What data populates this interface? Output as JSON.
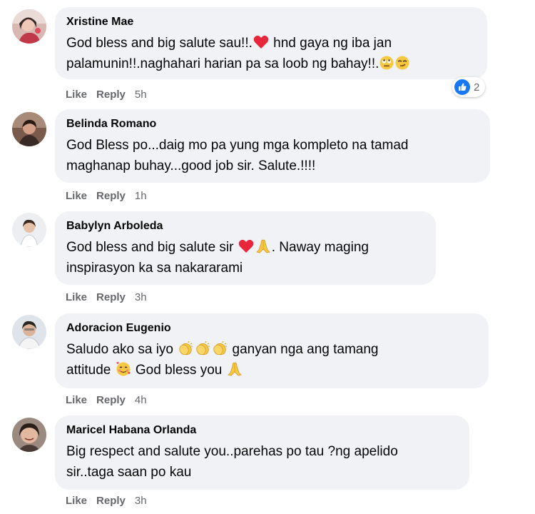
{
  "colors": {
    "bubble_bg": "#f0f2f5",
    "author_text": "#050505",
    "action_text": "#65676b",
    "like_blue": "#1877f2",
    "heart_red": "#e8263c",
    "emoji_yellow": "#f7c844"
  },
  "comments": [
    {
      "author": "Xristine Mae",
      "avatar_icon": "user-avatar-photo",
      "lines": [
        [
          "God bless and big salute sau!!.",
          "heart-emoji",
          " hnd gaya ng iba jan"
        ],
        [
          "palamunin!!.naghahari harian pa sa loob ng bahay!!.",
          "eye-roll-emoji",
          "smirk-emoji"
        ]
      ],
      "like_label": "Like",
      "reply_label": "Reply",
      "time": "5h",
      "reactions": {
        "icon": "like-reaction-icon",
        "count": "2"
      }
    },
    {
      "author": "Belinda Romano",
      "avatar_icon": "user-avatar-photo",
      "lines": [
        [
          "God Bless po...daig mo pa yung mga kompleto na tamad"
        ],
        [
          "maghanap buhay...good job sir. Salute.!!!!"
        ]
      ],
      "like_label": "Like",
      "reply_label": "Reply",
      "time": "1h"
    },
    {
      "author": "Babylyn Arboleda",
      "avatar_icon": "user-avatar-photo",
      "lines": [
        [
          "God bless and big salute sir ",
          "heart-emoji",
          "pray-emoji",
          ". Naway maging"
        ],
        [
          "inspirasyon ka sa nakararami"
        ]
      ],
      "like_label": "Like",
      "reply_label": "Reply",
      "time": "3h"
    },
    {
      "author": "Adoracion Eugenio",
      "avatar_icon": "user-avatar-photo",
      "lines": [
        [
          "Saludo ako sa iyo ",
          "clap-emoji",
          "clap-emoji",
          "clap-emoji",
          " ganyan nga ang tamang"
        ],
        [
          "attitude ",
          "smiling-hearts-emoji",
          " God bless you ",
          "pray-emoji"
        ]
      ],
      "like_label": "Like",
      "reply_label": "Reply",
      "time": "4h"
    },
    {
      "author": "Maricel Habana Orlanda",
      "avatar_icon": "user-avatar-photo",
      "lines": [
        [
          "Big respect and salute you..parehas po tau ?ng apelido"
        ],
        [
          "sir..taga saan po kau"
        ]
      ],
      "like_label": "Like",
      "reply_label": "Reply",
      "time": "3h"
    }
  ]
}
